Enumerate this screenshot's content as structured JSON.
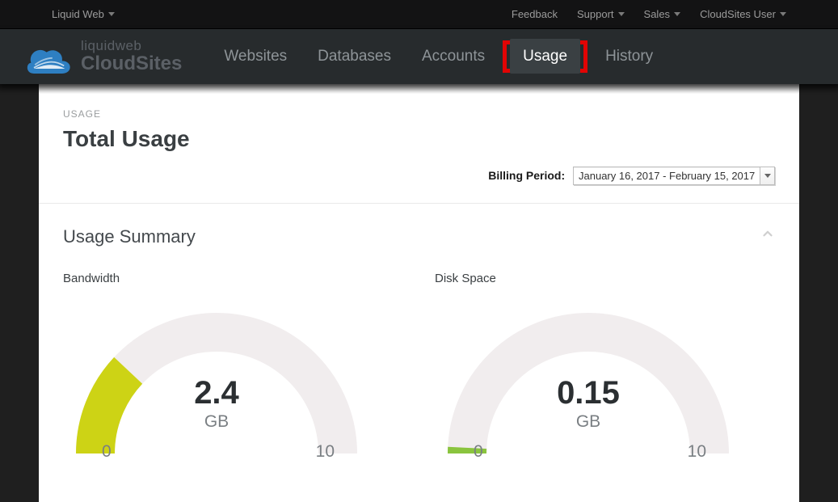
{
  "topbar": {
    "brand": "Liquid Web",
    "links": {
      "feedback": "Feedback",
      "support": "Support",
      "sales": "Sales",
      "user": "CloudSites User"
    }
  },
  "logo": {
    "line1": "liquidweb",
    "line2": "CloudSites"
  },
  "nav": {
    "websites": "Websites",
    "databases": "Databases",
    "accounts": "Accounts",
    "usage": "Usage",
    "history": "History"
  },
  "page": {
    "crumb": "USAGE",
    "title": "Total Usage",
    "billing_label": "Billing Period:",
    "billing_value": "January 16, 2017 - February 15, 2017"
  },
  "summary": {
    "title": "Usage Summary",
    "bandwidth_label": "Bandwidth",
    "disk_label": "Disk Space"
  },
  "chart_data": [
    {
      "type": "gauge",
      "name": "Bandwidth",
      "value": 2.4,
      "display_value": "2.4",
      "unit": "GB",
      "min": 0,
      "max": 10,
      "min_label": "0",
      "max_label": "10",
      "color": "#cdd315"
    },
    {
      "type": "gauge",
      "name": "Disk Space",
      "value": 0.15,
      "display_value": "0.15",
      "unit": "GB",
      "min": 0,
      "max": 10,
      "min_label": "0",
      "max_label": "10",
      "color": "#8ac43e"
    }
  ]
}
